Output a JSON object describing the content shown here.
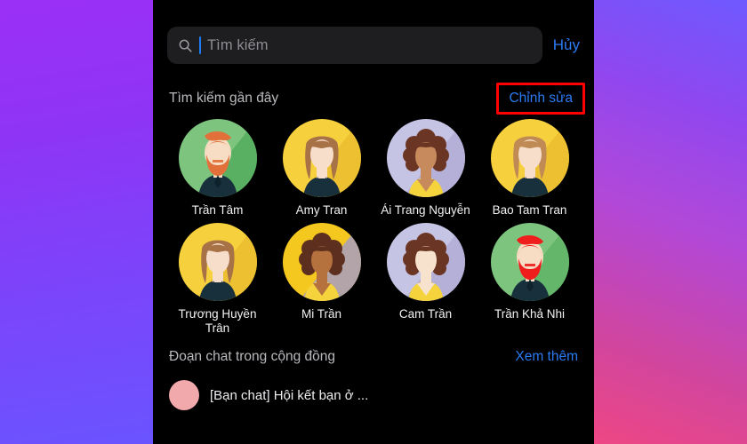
{
  "search": {
    "placeholder": "Tìm kiếm",
    "value": "",
    "cancel_label": "Hủy",
    "icon": "search-icon",
    "caret_color": "#1f7bf5"
  },
  "recent": {
    "title": "Tìm kiếm gần đây",
    "action_label": "Chỉnh sửa",
    "action_color": "#2b7bf3",
    "highlight_color": "#ff0000",
    "people": [
      {
        "name": "Trần Tâm",
        "avatar": "bearded-man",
        "bg": "#7dc47f",
        "bg_shadow": "#4faa58",
        "hair": "#e2703a",
        "skin": "#f6ddc3",
        "shirt": "#17303c"
      },
      {
        "name": "Amy Tran",
        "avatar": "wavy-hair-woman",
        "bg": "#f7d13d",
        "bg_shadow": "#e8b92c",
        "hair": "#a87247",
        "skin": "#f7decb",
        "shirt": "#17303c"
      },
      {
        "name": "Ái Trang Nguyễn",
        "avatar": "curly-woman",
        "bg": "#c6c4e4",
        "bg_shadow": "#adaad4",
        "hair": "#6b3524",
        "skin": "#c78a5c",
        "shirt": "#f5d33c"
      },
      {
        "name": "Bao Tam Tran",
        "avatar": "wavy-hair-woman",
        "bg": "#f7d13d",
        "bg_shadow": "#e8b92c",
        "hair": "#c08a55",
        "skin": "#f7decb",
        "shirt": "#17303c"
      },
      {
        "name": "Trương Huyền Trân",
        "avatar": "wavy-hair-woman",
        "bg": "#f7d13d",
        "bg_shadow": "#e8b92c",
        "hair": "#a87247",
        "skin": "#f7decb",
        "shirt": "#17303c"
      },
      {
        "name": "Mi Trần",
        "avatar": "curly-woman",
        "bg": "#f5c81f",
        "bg_shadow": "#9c98d8",
        "hair": "#5c2f1f",
        "skin": "#b5723f",
        "shirt": "#f5d33c"
      },
      {
        "name": "Cam Trần",
        "avatar": "curly-woman",
        "bg": "#c6c4e4",
        "bg_shadow": "#adaad4",
        "hair": "#6b3524",
        "skin": "#f7e2cd",
        "shirt": "#f5d33c"
      },
      {
        "name": "Trần Khả Nhi",
        "avatar": "bearded-man",
        "bg": "#7dc47f",
        "bg_shadow": "#5cb264",
        "hair": "#f01d1d",
        "skin": "#f6ddc3",
        "shirt": "#17303c"
      }
    ]
  },
  "community": {
    "title": "Đoạn chat trong cộng đồng",
    "action_label": "Xem thêm",
    "first_row_text": "[Bạn chat] Hội kết bạn ở ..."
  }
}
